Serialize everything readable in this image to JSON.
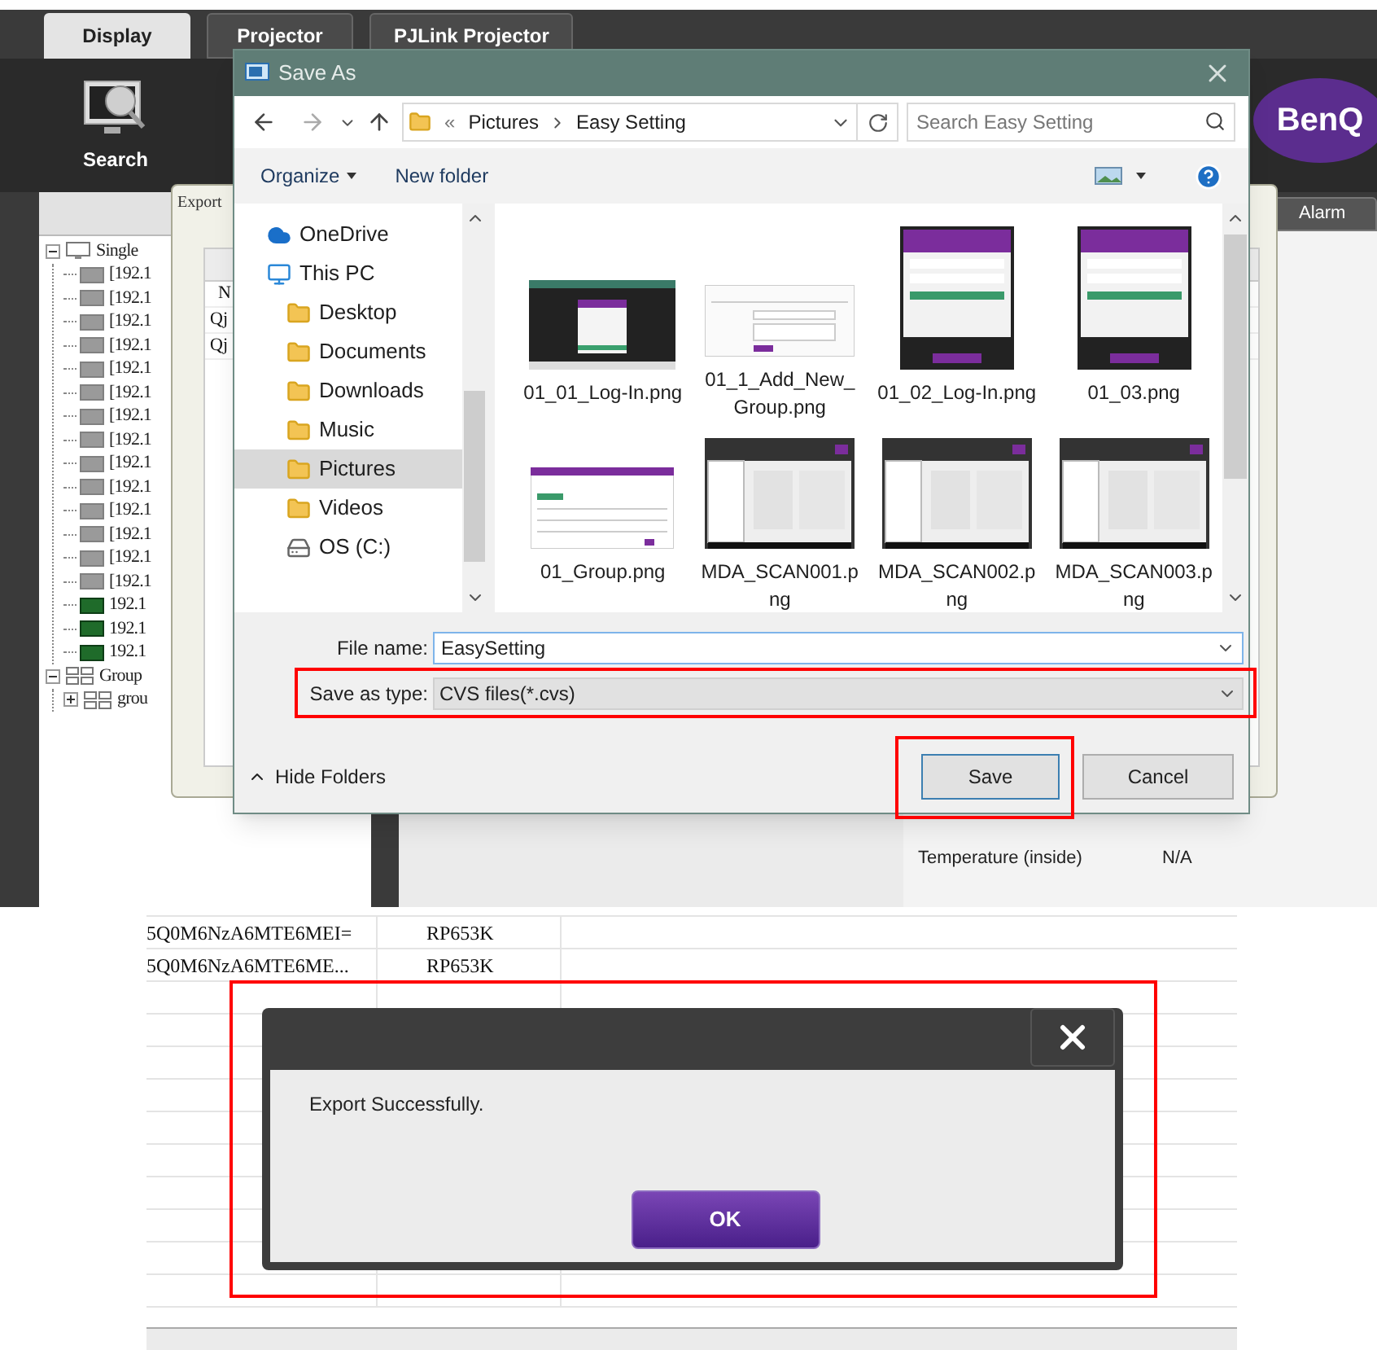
{
  "app": {
    "tabs": [
      {
        "label": "Display",
        "selected": true
      },
      {
        "label": "Projector",
        "selected": false
      },
      {
        "label": "PJLink Projector",
        "selected": false
      }
    ],
    "toolbar": {
      "search_label": "Search"
    },
    "logo": "BenQ",
    "alarm_tab": "Alarm",
    "tree": [
      {
        "label": "Single",
        "kind": "monitor",
        "expanded": true,
        "children": [
          {
            "label": "[192.1",
            "kind": "device",
            "online": false
          },
          {
            "label": "[192.1",
            "kind": "device",
            "online": false
          },
          {
            "label": "[192.1",
            "kind": "device",
            "online": false
          },
          {
            "label": "[192.1",
            "kind": "device",
            "online": false
          },
          {
            "label": "[192.1",
            "kind": "device",
            "online": false
          },
          {
            "label": "[192.1",
            "kind": "device",
            "online": false
          },
          {
            "label": "[192.1",
            "kind": "device",
            "online": false
          },
          {
            "label": "[192.1",
            "kind": "device",
            "online": false
          },
          {
            "label": "[192.1",
            "kind": "device",
            "online": false
          },
          {
            "label": "[192.1",
            "kind": "device",
            "online": false
          },
          {
            "label": "[192.1",
            "kind": "device",
            "online": false
          },
          {
            "label": "[192.1",
            "kind": "device",
            "online": false
          },
          {
            "label": "[192.1",
            "kind": "device",
            "online": false
          },
          {
            "label": "[192.1",
            "kind": "device",
            "online": false
          },
          {
            "label": "192.1",
            "kind": "device",
            "online": true
          },
          {
            "label": "192.1",
            "kind": "device",
            "online": true
          },
          {
            "label": "192.1",
            "kind": "device",
            "online": true
          }
        ]
      },
      {
        "label": "Group",
        "kind": "group",
        "expanded": true,
        "children": [
          {
            "label": "grou",
            "kind": "group",
            "expanded": false
          }
        ]
      }
    ],
    "export_window": {
      "title": "Export",
      "cells": [
        "N",
        "Qj",
        "Qj"
      ]
    },
    "status": [
      {
        "label": "Temperature (inside)",
        "value": "N/A"
      }
    ]
  },
  "save_as": {
    "title": "Save As",
    "overflow_mark": "«",
    "path": [
      "Pictures",
      "Easy Setting"
    ],
    "search": {
      "placeholder": "Search Easy Setting"
    },
    "toolbar": {
      "organize": "Organize",
      "new_folder": "New folder"
    },
    "nav": [
      {
        "label": "OneDrive",
        "kind": "cloud",
        "selected": false
      },
      {
        "label": "This PC",
        "kind": "pc",
        "selected": false,
        "children": [
          {
            "label": "Desktop",
            "kind": "folder",
            "selected": false
          },
          {
            "label": "Documents",
            "kind": "folder",
            "selected": false
          },
          {
            "label": "Downloads",
            "kind": "folder",
            "selected": false
          },
          {
            "label": "Music",
            "kind": "folder",
            "selected": false
          },
          {
            "label": "Pictures",
            "kind": "folder",
            "selected": true
          },
          {
            "label": "Videos",
            "kind": "folder",
            "selected": false
          },
          {
            "label": "OS (C:)",
            "kind": "drive",
            "selected": false
          }
        ]
      }
    ],
    "files": [
      {
        "name": "01_01_Log-In.png",
        "kind": "wide"
      },
      {
        "name": "01_1_Add_New_Group.png",
        "kind": "form"
      },
      {
        "name": "01_02_Log-In.png",
        "kind": "login"
      },
      {
        "name": "01_03.png",
        "kind": "login"
      },
      {
        "name": "01_Group.png",
        "kind": "table"
      },
      {
        "name": "MDA_SCAN001.png",
        "kind": "scan"
      },
      {
        "name": "MDA_SCAN002.png",
        "kind": "scan"
      },
      {
        "name": "MDA_SCAN003.png",
        "kind": "scan"
      }
    ],
    "file_name": {
      "label": "File name:",
      "value": "EasySetting"
    },
    "save_type": {
      "label": "Save as type:",
      "value": "CVS files(*.cvs)",
      "highlighted": true
    },
    "hide_folders": "Hide Folders",
    "save_button": {
      "label": "Save",
      "highlighted": true
    },
    "cancel_button": "Cancel"
  },
  "table": {
    "rows": [
      [
        "5Q0M6NzA6MTE6MEI=",
        "RP653K"
      ],
      [
        "5Q0M6NzA6MTE6ME...",
        "RP653K"
      ]
    ]
  },
  "message": {
    "text": "Export Successfully.",
    "button": "OK",
    "highlighted": true
  }
}
